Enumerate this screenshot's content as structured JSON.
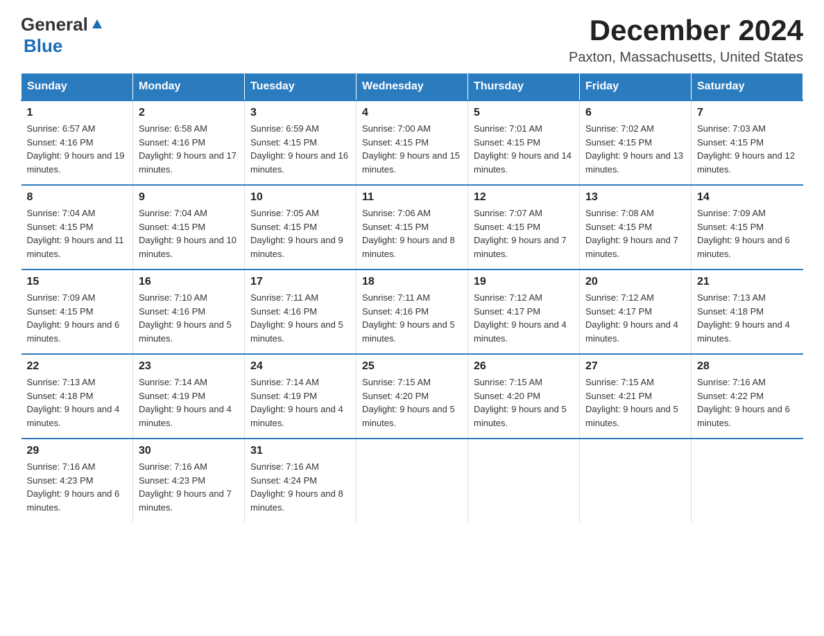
{
  "header": {
    "logo_line1": "General",
    "logo_line2": "Blue",
    "month_title": "December 2024",
    "location": "Paxton, Massachusetts, United States"
  },
  "weekdays": [
    "Sunday",
    "Monday",
    "Tuesday",
    "Wednesday",
    "Thursday",
    "Friday",
    "Saturday"
  ],
  "weeks": [
    [
      {
        "day": "1",
        "sunrise": "6:57 AM",
        "sunset": "4:16 PM",
        "daylight": "9 hours and 19 minutes."
      },
      {
        "day": "2",
        "sunrise": "6:58 AM",
        "sunset": "4:16 PM",
        "daylight": "9 hours and 17 minutes."
      },
      {
        "day": "3",
        "sunrise": "6:59 AM",
        "sunset": "4:15 PM",
        "daylight": "9 hours and 16 minutes."
      },
      {
        "day": "4",
        "sunrise": "7:00 AM",
        "sunset": "4:15 PM",
        "daylight": "9 hours and 15 minutes."
      },
      {
        "day": "5",
        "sunrise": "7:01 AM",
        "sunset": "4:15 PM",
        "daylight": "9 hours and 14 minutes."
      },
      {
        "day": "6",
        "sunrise": "7:02 AM",
        "sunset": "4:15 PM",
        "daylight": "9 hours and 13 minutes."
      },
      {
        "day": "7",
        "sunrise": "7:03 AM",
        "sunset": "4:15 PM",
        "daylight": "9 hours and 12 minutes."
      }
    ],
    [
      {
        "day": "8",
        "sunrise": "7:04 AM",
        "sunset": "4:15 PM",
        "daylight": "9 hours and 11 minutes."
      },
      {
        "day": "9",
        "sunrise": "7:04 AM",
        "sunset": "4:15 PM",
        "daylight": "9 hours and 10 minutes."
      },
      {
        "day": "10",
        "sunrise": "7:05 AM",
        "sunset": "4:15 PM",
        "daylight": "9 hours and 9 minutes."
      },
      {
        "day": "11",
        "sunrise": "7:06 AM",
        "sunset": "4:15 PM",
        "daylight": "9 hours and 8 minutes."
      },
      {
        "day": "12",
        "sunrise": "7:07 AM",
        "sunset": "4:15 PM",
        "daylight": "9 hours and 7 minutes."
      },
      {
        "day": "13",
        "sunrise": "7:08 AM",
        "sunset": "4:15 PM",
        "daylight": "9 hours and 7 minutes."
      },
      {
        "day": "14",
        "sunrise": "7:09 AM",
        "sunset": "4:15 PM",
        "daylight": "9 hours and 6 minutes."
      }
    ],
    [
      {
        "day": "15",
        "sunrise": "7:09 AM",
        "sunset": "4:15 PM",
        "daylight": "9 hours and 6 minutes."
      },
      {
        "day": "16",
        "sunrise": "7:10 AM",
        "sunset": "4:16 PM",
        "daylight": "9 hours and 5 minutes."
      },
      {
        "day": "17",
        "sunrise": "7:11 AM",
        "sunset": "4:16 PM",
        "daylight": "9 hours and 5 minutes."
      },
      {
        "day": "18",
        "sunrise": "7:11 AM",
        "sunset": "4:16 PM",
        "daylight": "9 hours and 5 minutes."
      },
      {
        "day": "19",
        "sunrise": "7:12 AM",
        "sunset": "4:17 PM",
        "daylight": "9 hours and 4 minutes."
      },
      {
        "day": "20",
        "sunrise": "7:12 AM",
        "sunset": "4:17 PM",
        "daylight": "9 hours and 4 minutes."
      },
      {
        "day": "21",
        "sunrise": "7:13 AM",
        "sunset": "4:18 PM",
        "daylight": "9 hours and 4 minutes."
      }
    ],
    [
      {
        "day": "22",
        "sunrise": "7:13 AM",
        "sunset": "4:18 PM",
        "daylight": "9 hours and 4 minutes."
      },
      {
        "day": "23",
        "sunrise": "7:14 AM",
        "sunset": "4:19 PM",
        "daylight": "9 hours and 4 minutes."
      },
      {
        "day": "24",
        "sunrise": "7:14 AM",
        "sunset": "4:19 PM",
        "daylight": "9 hours and 4 minutes."
      },
      {
        "day": "25",
        "sunrise": "7:15 AM",
        "sunset": "4:20 PM",
        "daylight": "9 hours and 5 minutes."
      },
      {
        "day": "26",
        "sunrise": "7:15 AM",
        "sunset": "4:20 PM",
        "daylight": "9 hours and 5 minutes."
      },
      {
        "day": "27",
        "sunrise": "7:15 AM",
        "sunset": "4:21 PM",
        "daylight": "9 hours and 5 minutes."
      },
      {
        "day": "28",
        "sunrise": "7:16 AM",
        "sunset": "4:22 PM",
        "daylight": "9 hours and 6 minutes."
      }
    ],
    [
      {
        "day": "29",
        "sunrise": "7:16 AM",
        "sunset": "4:23 PM",
        "daylight": "9 hours and 6 minutes."
      },
      {
        "day": "30",
        "sunrise": "7:16 AM",
        "sunset": "4:23 PM",
        "daylight": "9 hours and 7 minutes."
      },
      {
        "day": "31",
        "sunrise": "7:16 AM",
        "sunset": "4:24 PM",
        "daylight": "9 hours and 8 minutes."
      },
      null,
      null,
      null,
      null
    ]
  ]
}
